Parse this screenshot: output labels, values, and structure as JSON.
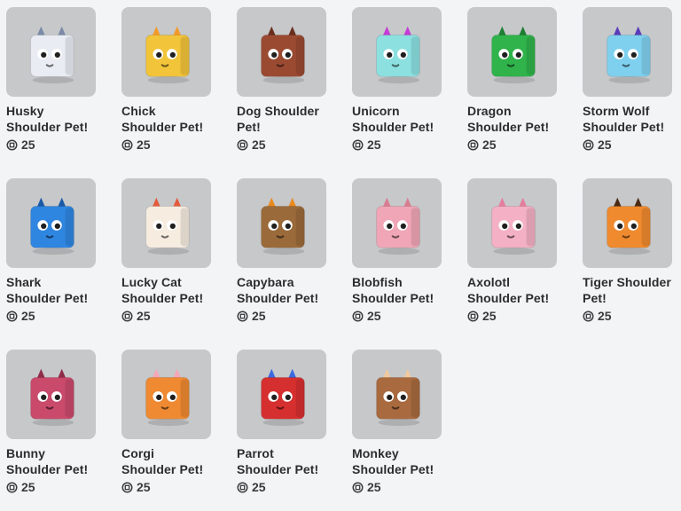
{
  "catalog": {
    "items": [
      {
        "name": "Husky\nShoulder Pet!",
        "price": "25",
        "icon": "husky-icon",
        "color": "#e9edf3",
        "accent": "#7b8aa6"
      },
      {
        "name": "Chick\nShoulder Pet!",
        "price": "25",
        "icon": "chick-icon",
        "color": "#f2c43a",
        "accent": "#f39a2a"
      },
      {
        "name": "Dog Shoulder\nPet!",
        "price": "25",
        "icon": "dog-icon",
        "color": "#9b4a32",
        "accent": "#6a2e1f"
      },
      {
        "name": "Unicorn\nShoulder Pet!",
        "price": "25",
        "icon": "unicorn-icon",
        "color": "#8ce0e0",
        "accent": "#c43bd6"
      },
      {
        "name": "Dragon\nShoulder Pet!",
        "price": "25",
        "icon": "dragon-icon",
        "color": "#2fb34a",
        "accent": "#1e7e34"
      },
      {
        "name": "Storm Wolf\nShoulder Pet!",
        "price": "25",
        "icon": "storm-wolf-icon",
        "color": "#7fd0ee",
        "accent": "#5b3bb8"
      },
      {
        "name": "Shark\nShoulder Pet!",
        "price": "25",
        "icon": "shark-icon",
        "color": "#2f86e0",
        "accent": "#1a5aa6"
      },
      {
        "name": "Lucky Cat\nShoulder Pet!",
        "price": "25",
        "icon": "lucky-cat-icon",
        "color": "#f6ece0",
        "accent": "#e45a3a"
      },
      {
        "name": "Capybara\nShoulder Pet!",
        "price": "25",
        "icon": "capybara-icon",
        "color": "#9b6a3a",
        "accent": "#e98a1e"
      },
      {
        "name": "Blobfish\nShoulder Pet!",
        "price": "25",
        "icon": "blobfish-icon",
        "color": "#f0a6b6",
        "accent": "#d97d92"
      },
      {
        "name": "Axolotl\nShoulder Pet!",
        "price": "25",
        "icon": "axolotl-icon",
        "color": "#f4b0c4",
        "accent": "#e57d9e"
      },
      {
        "name": "Tiger Shoulder\nPet!",
        "price": "25",
        "icon": "tiger-icon",
        "color": "#ef8a2e",
        "accent": "#4a2a14"
      },
      {
        "name": "Bunny\nShoulder Pet!",
        "price": "25",
        "icon": "bunny-icon",
        "color": "#c94a6b",
        "accent": "#8f2d48"
      },
      {
        "name": "Corgi\nShoulder Pet!",
        "price": "25",
        "icon": "corgi-icon",
        "color": "#ef8a32",
        "accent": "#f6a6b6"
      },
      {
        "name": "Parrot\nShoulder Pet!",
        "price": "25",
        "icon": "parrot-icon",
        "color": "#d62f2f",
        "accent": "#3b6ae0"
      },
      {
        "name": "Monkey\nShoulder Pet!",
        "price": "25",
        "icon": "monkey-icon",
        "color": "#a86a3e",
        "accent": "#f0c9a0"
      }
    ]
  }
}
